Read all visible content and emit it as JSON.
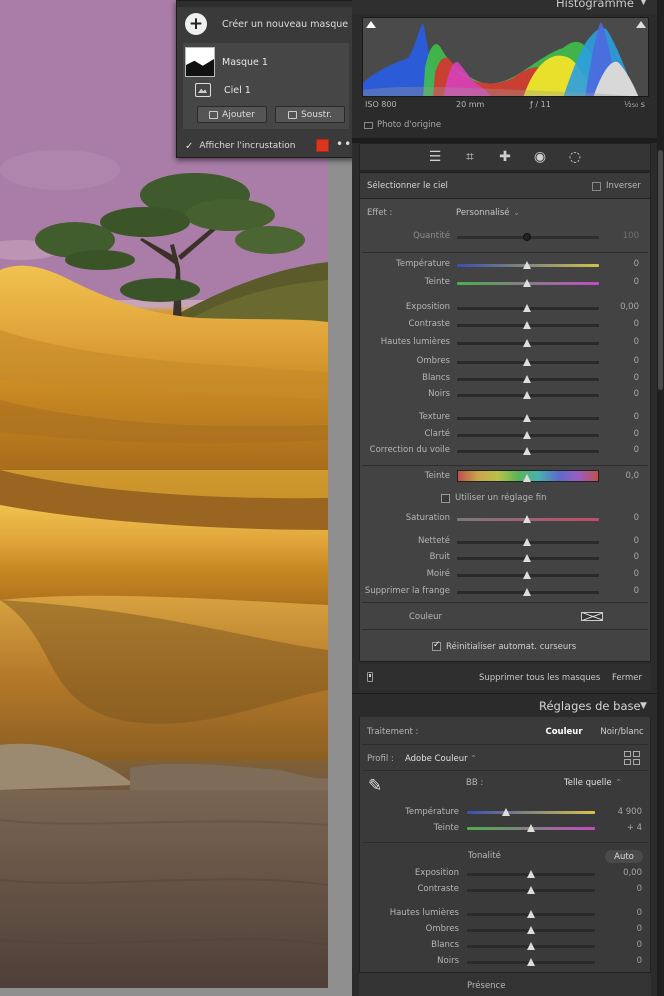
{
  "mask_panel": {
    "create_label": "Créer un nouveau masque",
    "masks": [
      {
        "label": "Masque 1"
      },
      {
        "label": "Ciel 1"
      }
    ],
    "add_label": "Ajouter",
    "subtract_label": "Soustr.",
    "overlay_label": "Afficher l'incrustation",
    "overlay_color": "#d9351f"
  },
  "histogram": {
    "title": "Histogramme",
    "iso": "ISO 800",
    "focal": "20 mm",
    "aperture": "ƒ / 11",
    "shutter": "¹⁄₂₅₀ s",
    "original_label": "Photo d'origine"
  },
  "mask_settings": {
    "target_label": "Sélectionner le ciel",
    "invert_label": "Inverser",
    "effect_label": "Effet :",
    "effect_value": "Personnalisé",
    "amount_label": "Quantité",
    "amount_value": "100",
    "sliders": [
      {
        "label": "Température",
        "value": "0"
      },
      {
        "label": "Teinte",
        "value": "0"
      },
      {
        "label": "Exposition",
        "value": "0,00"
      },
      {
        "label": "Contraste",
        "value": "0"
      },
      {
        "label": "Hautes lumières",
        "value": "0"
      },
      {
        "label": "Ombres",
        "value": "0"
      },
      {
        "label": "Blancs",
        "value": "0"
      },
      {
        "label": "Noirs",
        "value": "0"
      },
      {
        "label": "Texture",
        "value": "0"
      },
      {
        "label": "Clarté",
        "value": "0"
      },
      {
        "label": "Correction du voile",
        "value": "0"
      }
    ],
    "hue_label": "Teinte",
    "hue_value": "0,0",
    "fine_adjust_label": "Utiliser un réglage fin",
    "sliders2": [
      {
        "label": "Saturation",
        "value": "0"
      },
      {
        "label": "Netteté",
        "value": "0"
      },
      {
        "label": "Bruit",
        "value": "0"
      },
      {
        "label": "Moiré",
        "value": "0"
      },
      {
        "label": "Supprimer la frange",
        "value": "0"
      }
    ],
    "color_label": "Couleur",
    "reset_label": "Réinitialiser automat. curseurs",
    "delete_all_label": "Supprimer tous les masques",
    "close_label": "Fermer"
  },
  "basic": {
    "title": "Réglages de base",
    "treatment_label": "Traitement :",
    "color_btn": "Couleur",
    "bw_btn": "Noir/blanc",
    "profile_label": "Profil :",
    "profile_value": "Adobe Couleur",
    "wb_label": "BB :",
    "wb_value": "Telle quelle",
    "temp_label": "Température",
    "temp_value": "4 900",
    "tint_label": "Teinte",
    "tint_value": "+ 4",
    "tone_label": "Tonalité",
    "auto_label": "Auto",
    "sliders": [
      {
        "label": "Exposition",
        "value": "0,00"
      },
      {
        "label": "Contraste",
        "value": "0"
      },
      {
        "label": "Hautes lumières",
        "value": "0"
      },
      {
        "label": "Ombres",
        "value": "0"
      },
      {
        "label": "Blancs",
        "value": "0"
      },
      {
        "label": "Noirs",
        "value": "0"
      }
    ],
    "presence_label": "Présence"
  }
}
